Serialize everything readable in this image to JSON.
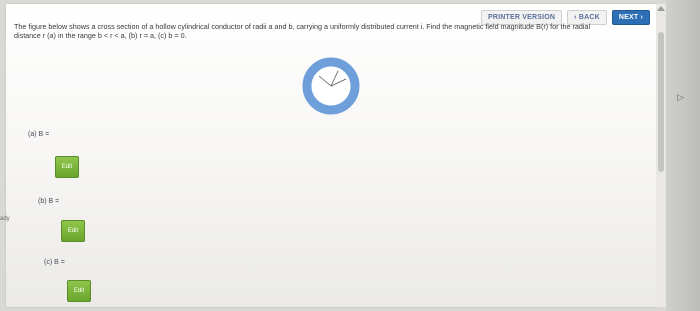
{
  "nav": {
    "printer_label": "PRINTER VERSION",
    "back_label": "‹ BACK",
    "next_label": "NEXT ›"
  },
  "problem": {
    "line1": "The figure below shows a cross section of a hollow cylindrical conductor of radii a and b, carrying a uniformly distributed current i. Find the magnetic field magnitude B(r) for the radial",
    "line2": "distance r (a) in the range b < r < a, (b) r = a, (c) b = 0."
  },
  "answers": [
    {
      "label": "(a) B =",
      "edit": "Edit"
    },
    {
      "label": "(b) B =",
      "edit": "Edit"
    },
    {
      "label": "(c) B =",
      "edit": "Edit"
    }
  ],
  "side_text": "ady",
  "colors": {
    "ring": "#6f9fda",
    "edit_green": "#7bb83a",
    "next_blue": "#2d6fb4"
  }
}
